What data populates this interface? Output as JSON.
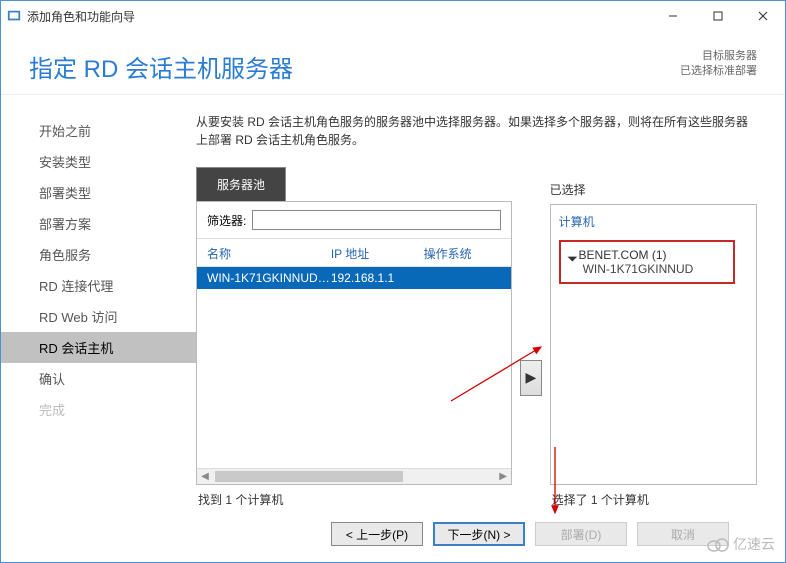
{
  "window": {
    "title": "添加角色和功能向导"
  },
  "header": {
    "page_title": "指定 RD 会话主机服务器",
    "target_label": "目标服务器",
    "target_sub": "已选择标准部署"
  },
  "sidebar": {
    "items": [
      {
        "label": "开始之前"
      },
      {
        "label": "安装类型"
      },
      {
        "label": "部署类型"
      },
      {
        "label": "部署方案"
      },
      {
        "label": "角色服务"
      },
      {
        "label": "RD 连接代理"
      },
      {
        "label": "RD Web 访问"
      },
      {
        "label": "RD 会话主机"
      },
      {
        "label": "确认"
      },
      {
        "label": "完成"
      }
    ]
  },
  "main": {
    "instruction": "从要安装 RD 会话主机角色服务的服务器池中选择服务器。如果选择多个服务器，则将在所有这些服务器上部署 RD 会话主机角色服务。",
    "tab_label": "服务器池",
    "filter_label": "筛选器:",
    "filter_value": "",
    "cols": {
      "name": "名称",
      "ip": "IP 地址",
      "os": "操作系统"
    },
    "servers": [
      {
        "name": "WIN-1K71GKINNUD.b...",
        "ip": "192.168.1.1",
        "os": ""
      }
    ],
    "found_text": "找到 1 个计算机",
    "selected_label": "已选择",
    "computer_header": "计算机",
    "selected_group": {
      "title": "BENET.COM (1)",
      "item": "WIN-1K71GKINNUD"
    },
    "selected_footer": "选择了 1 个计算机"
  },
  "buttons": {
    "prev": "< 上一步(P)",
    "next": "下一步(N) >",
    "deploy": "部署(D)",
    "cancel": "取消"
  },
  "watermark": "亿速云"
}
